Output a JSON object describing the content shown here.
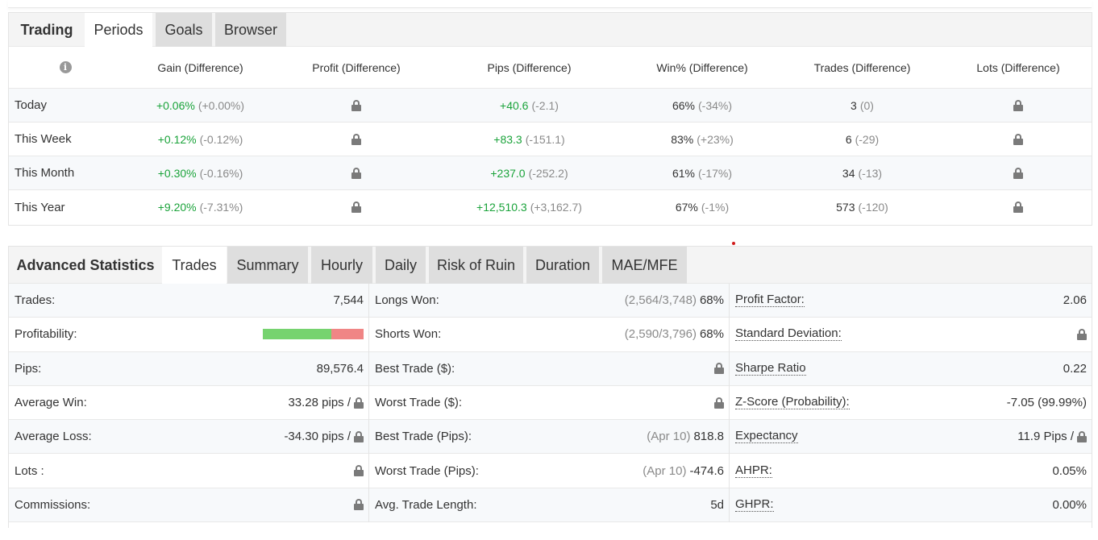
{
  "periods": {
    "tabs": [
      {
        "label": "Trading",
        "state": "title"
      },
      {
        "label": "Periods",
        "state": "active"
      },
      {
        "label": "Goals",
        "state": "inactive"
      },
      {
        "label": "Browser",
        "state": "inactive"
      }
    ],
    "headers": [
      "Gain (Difference)",
      "Profit (Difference)",
      "Pips (Difference)",
      "Win% (Difference)",
      "Trades (Difference)",
      "Lots (Difference)"
    ],
    "rows": [
      {
        "label": "Today",
        "gain": "+0.06%",
        "gain_diff": "(+0.00%)",
        "pips": "+40.6",
        "pips_diff": "(-2.1)",
        "win": "66%",
        "win_diff": "(-34%)",
        "trades": "3",
        "trades_diff": "(0)"
      },
      {
        "label": "This Week",
        "gain": "+0.12%",
        "gain_diff": "(-0.12%)",
        "pips": "+83.3",
        "pips_diff": "(-151.1)",
        "win": "83%",
        "win_diff": "(+23%)",
        "trades": "6",
        "trades_diff": "(-29)"
      },
      {
        "label": "This Month",
        "gain": "+0.30%",
        "gain_diff": "(-0.16%)",
        "pips": "+237.0",
        "pips_diff": "(-252.2)",
        "win": "61%",
        "win_diff": "(-17%)",
        "trades": "34",
        "trades_diff": "(-13)"
      },
      {
        "label": "This Year",
        "gain": "+9.20%",
        "gain_diff": "(-7.31%)",
        "pips": "+12,510.3",
        "pips_diff": "(+3,162.7)",
        "win": "67%",
        "win_diff": "(-1%)",
        "trades": "573",
        "trades_diff": "(-120)"
      }
    ]
  },
  "advanced": {
    "title": "Advanced Statistics",
    "tabs": [
      "Trades",
      "Summary",
      "Hourly",
      "Daily",
      "Risk of Ruin",
      "Duration",
      "MAE/MFE"
    ],
    "active_tab": "Trades",
    "col1": [
      {
        "label": "Trades:",
        "value": "7,544"
      },
      {
        "label": "Profitability:",
        "win_fraction": 0.68
      },
      {
        "label": "Pips:",
        "value": "89,576.4"
      },
      {
        "label": "Average Win:",
        "value": "33.28 pips /",
        "locked": true
      },
      {
        "label": "Average Loss:",
        "value": "-34.30 pips /",
        "locked": true
      },
      {
        "label": "Lots :",
        "locked": true
      },
      {
        "label": "Commissions:",
        "locked": true
      }
    ],
    "col2": [
      {
        "label": "Longs Won:",
        "muted": "(2,564/3,748)",
        "value": "68%"
      },
      {
        "label": "Shorts Won:",
        "muted": "(2,590/3,796)",
        "value": "68%"
      },
      {
        "label": "Best Trade ($):",
        "locked": true
      },
      {
        "label": "Worst Trade ($):",
        "locked": true
      },
      {
        "label": "Best Trade (Pips):",
        "muted": "(Apr 10)",
        "value": "818.8"
      },
      {
        "label": "Worst Trade (Pips):",
        "muted": "(Apr 10)",
        "value": "-474.6"
      },
      {
        "label": "Avg. Trade Length:",
        "value": "5d"
      }
    ],
    "col3": [
      {
        "label": "Profit Factor:",
        "value": "2.06"
      },
      {
        "label": "Standard Deviation:",
        "locked": true
      },
      {
        "label": "Sharpe Ratio",
        "value": "0.22"
      },
      {
        "label": "Z-Score (Probability):",
        "value": "-7.05 (99.99%)"
      },
      {
        "label": "Expectancy",
        "value": "11.9 Pips /",
        "locked": true
      },
      {
        "label": "AHPR:",
        "value": "0.05%"
      },
      {
        "label": "GHPR:",
        "value": "0.00%"
      }
    ]
  },
  "colors": {
    "positive": "#1aa33a",
    "muted": "#8a8a8a",
    "bar_win": "#76d36f",
    "bar_loss": "#f08585"
  }
}
